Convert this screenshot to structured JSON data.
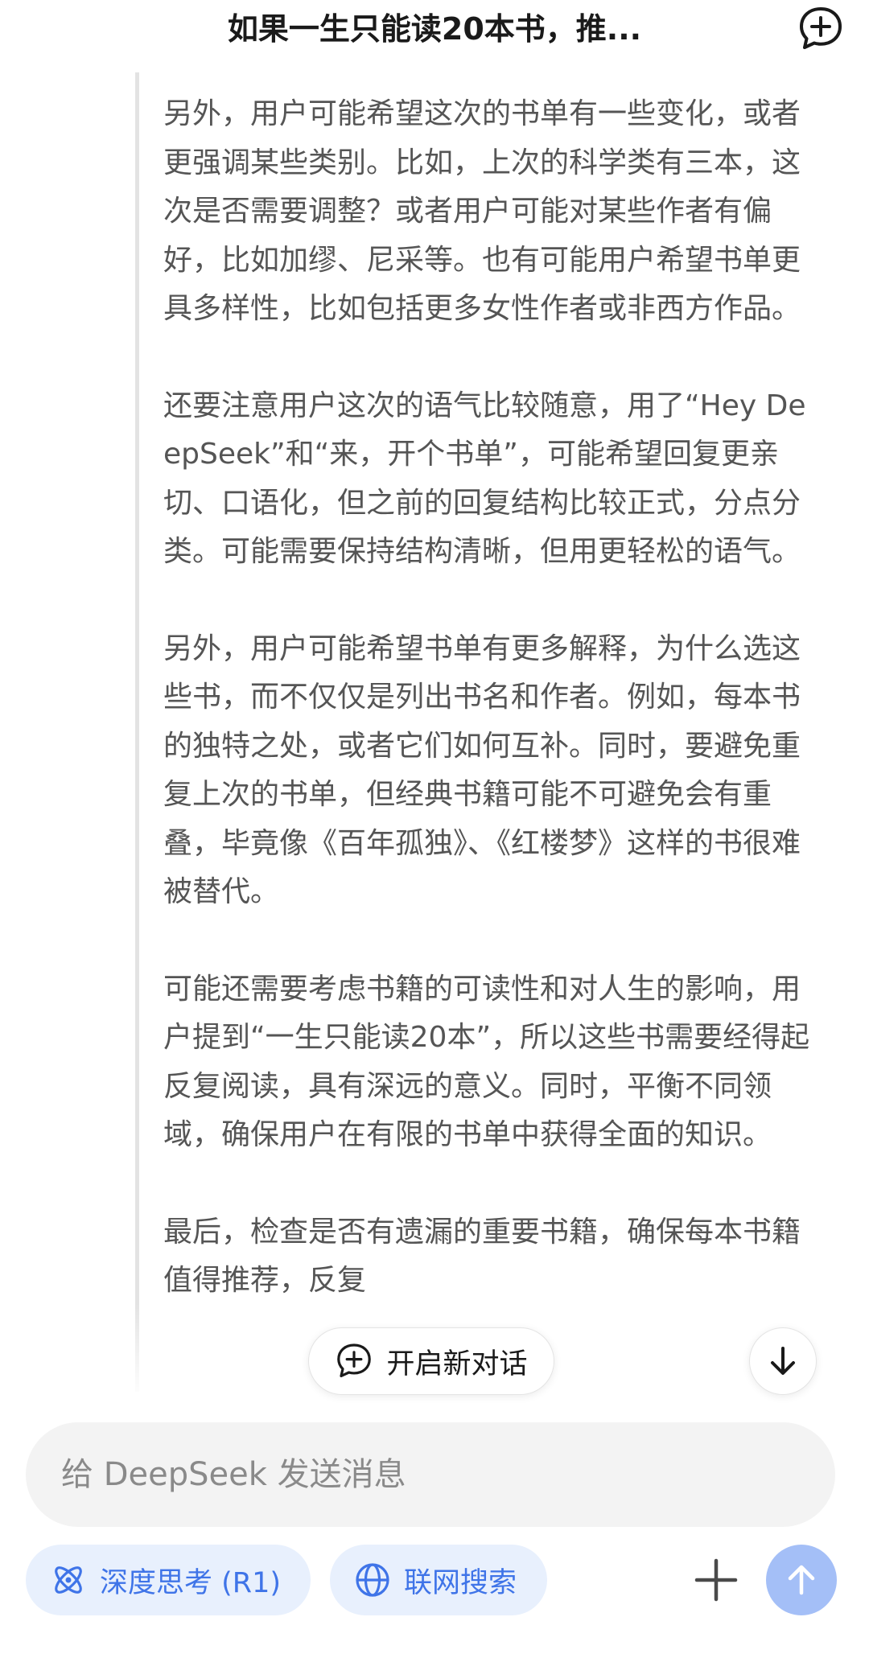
{
  "header": {
    "title": "如果一生只能读20本书，推..."
  },
  "thinking": {
    "paragraphs": [
      "另外，用户可能希望这次的书单有一些变化，或者更强调某些类别。比如，上次的科学类有三本，这次是否需要调整？或者用户可能对某些作者有偏好，比如加缪、尼采等。也有可能用户希望书单更具多样性，比如包括更多女性作者或非西方作品。",
      "还要注意用户这次的语气比较随意，用了“Hey DeepSeek”和“来，开个书单”，可能希望回复更亲切、口语化，但之前的回复结构比较正式，分点分类。可能需要保持结构清晰，但用更轻松的语气。",
      "另外，用户可能希望书单有更多解释，为什么选这些书，而不仅仅是列出书名和作者。例如，每本书的独特之处，或者它们如何互补。同时，要避免重复上次的书单，但经典书籍可能不可避免会有重叠，毕竟像《百年孤独》、《红楼梦》这样的书很难被替代。",
      "可能还需要考虑书籍的可读性和对人生的影响，用户提到“一生只能读20本”，所以这些书需要经得起反复阅读，具有深远的意义。同时，平衡不同领域，确保用户在有限的书单中获得全面的知识。",
      "最后，检查是否有遗漏的重要书籍，确保每本书籍值得推荐，反复"
    ]
  },
  "floating": {
    "new_chat_label": "开启新对话"
  },
  "composer": {
    "placeholder": "给 DeepSeek 发送消息"
  },
  "toolbar": {
    "deep_think_label": "深度思考 (R1)",
    "web_search_label": "联网搜索"
  },
  "colors": {
    "accent": "#3f74e8",
    "pill_bg": "#e8f0fd",
    "send_disabled": "#a4bff7"
  },
  "icons": {
    "header_new_chat": "chat-bubble-plus-icon",
    "new_chat": "chat-bubble-plus-icon",
    "scroll_down": "arrow-down-icon",
    "deep_think": "atom-icon",
    "web_search": "globe-icon",
    "attach": "plus-icon",
    "send": "arrow-up-icon"
  }
}
